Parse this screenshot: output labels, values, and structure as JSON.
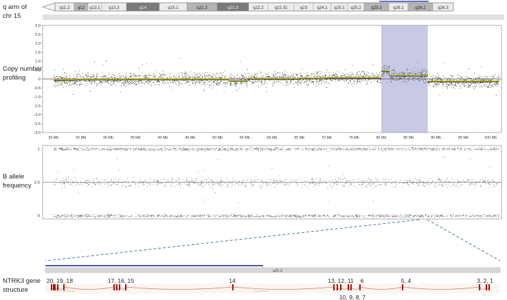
{
  "labels": {
    "chromosome": "q arm of chr 15",
    "cnp": "Copy number profiling",
    "baf": "B allele frequency",
    "gene": "NTRK3 gene structure"
  },
  "ideogram": {
    "bands": [
      {
        "name": "q11.2",
        "shade": "light"
      },
      {
        "name": "q12",
        "shade": "mid"
      },
      {
        "name": "q13.1",
        "shade": "light"
      },
      {
        "name": "q13.3",
        "shade": "light"
      },
      {
        "name": "q14",
        "shade": "dark"
      },
      {
        "name": "q15.1",
        "shade": "light"
      },
      {
        "name": "q21.2",
        "shade": "mid"
      },
      {
        "name": "q21.3",
        "shade": "dark"
      },
      {
        "name": "q22.2",
        "shade": "light"
      },
      {
        "name": "q22.31",
        "shade": "light"
      },
      {
        "name": "q23",
        "shade": "light"
      },
      {
        "name": "q24.1",
        "shade": "light"
      },
      {
        "name": "q25.1",
        "shade": "light"
      },
      {
        "name": "q25.2",
        "shade": "light"
      },
      {
        "name": "q25.3",
        "shade": "mid"
      },
      {
        "name": "q26.1",
        "shade": "light"
      },
      {
        "name": "q26.2",
        "shade": "mid"
      },
      {
        "name": "q26.3",
        "shade": "light"
      }
    ]
  },
  "zoom_band_label": "q25.3",
  "colors": {
    "highlight": "#c9c9e6",
    "trend": "#b8b800",
    "exon": "#c00000",
    "intron": "#c87878",
    "blueline": "#3b3bb3",
    "dash": "#3b5fb3"
  },
  "chart_data": [
    {
      "type": "scatter",
      "name": "copy-number-profiling",
      "x_unit": "Mb",
      "xlim": [
        18,
        102
      ],
      "ylim": [
        -3.0,
        3.0
      ],
      "yticks": [
        "3.0",
        "2.5",
        "2.0",
        "1.5",
        "1.0",
        "0.5",
        "0",
        "-0.5",
        "-1.0",
        "-1.5",
        "-2.0",
        "-2.5",
        "-3.0"
      ],
      "xticks": [
        "20 Mb",
        "25 Mb",
        "30 Mb",
        "35 Mb",
        "40 Mb",
        "45 Mb",
        "50 Mb",
        "55 Mb",
        "60 Mb",
        "65 Mb",
        "70 Mb",
        "75 Mb",
        "80 Mb",
        "85 Mb",
        "90 Mb",
        "95 Mb",
        "100 Mb"
      ],
      "highlight_region": [
        80.0,
        88.5
      ],
      "segments": [
        {
          "x0": 20.0,
          "x1": 24.0,
          "y": -0.05
        },
        {
          "x0": 24.0,
          "x1": 33.5,
          "y": -0.02
        },
        {
          "x0": 33.5,
          "x1": 52.0,
          "y": 0.0
        },
        {
          "x0": 52.0,
          "x1": 55.5,
          "y": -0.08
        },
        {
          "x0": 55.5,
          "x1": 65.0,
          "y": 0.03
        },
        {
          "x0": 65.0,
          "x1": 70.0,
          "y": 0.05
        },
        {
          "x0": 70.0,
          "x1": 80.0,
          "y": 0.08
        },
        {
          "x0": 80.0,
          "x1": 81.5,
          "y": 0.45
        },
        {
          "x0": 81.5,
          "x1": 88.5,
          "y": 0.2
        },
        {
          "x0": 88.5,
          "x1": 101.5,
          "y": -0.12
        }
      ]
    },
    {
      "type": "scatter",
      "name": "b-allele-frequency",
      "x_unit": "Mb",
      "xlim": [
        18,
        102
      ],
      "ylim": [
        -0.05,
        1.05
      ],
      "yticks": [
        "1",
        "0.5",
        "0"
      ],
      "bands_y": [
        0,
        0.5,
        1
      ]
    }
  ],
  "gene": {
    "exons": [
      {
        "label": "20, 19, 18",
        "row": "top"
      },
      {
        "label": "17, 16, 15",
        "row": "top"
      },
      {
        "label": "14",
        "row": "top"
      },
      {
        "label": "13, 12, 11",
        "row": "top"
      },
      {
        "label": "6",
        "row": "top"
      },
      {
        "label": "5, 4",
        "row": "top"
      },
      {
        "label": "3, 2, 1",
        "row": "top"
      },
      {
        "label": "10, 9, 8, 7",
        "row": "bottom"
      }
    ]
  }
}
